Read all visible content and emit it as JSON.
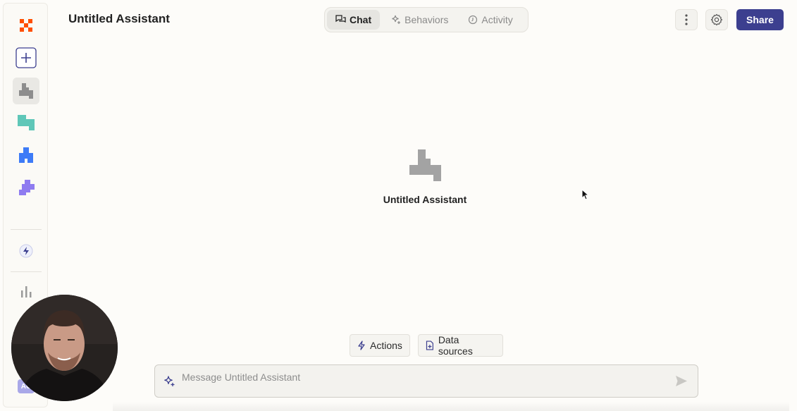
{
  "header": {
    "title": "Untitled Assistant",
    "tabs": [
      {
        "label": "Chat",
        "icon": "chat-bubbles-icon",
        "active": true
      },
      {
        "label": "Behaviors",
        "icon": "sparkle-icon",
        "active": false
      },
      {
        "label": "Activity",
        "icon": "clock-icon",
        "active": false
      }
    ],
    "share_label": "Share"
  },
  "sidebar": {
    "items": [
      {
        "icon": "zapier-logo-icon",
        "color": "#ff4f00"
      },
      {
        "icon": "plus-icon",
        "color": "#3c3f8f"
      },
      {
        "icon": "assistant-icon",
        "color": "#8d8d8d",
        "active": true
      },
      {
        "icon": "table-icon",
        "color": "#5fc7b8"
      },
      {
        "icon": "interface-icon",
        "color": "#3d7bf7"
      },
      {
        "icon": "puzzle-icon",
        "color": "#8f7cf0"
      },
      {
        "icon": "lightning-icon",
        "color": "#3c3f8f"
      },
      {
        "icon": "bar-chart-icon",
        "color": "#9a9a9a"
      }
    ],
    "avatar_initials": "AC"
  },
  "main": {
    "assistant_name": "Untitled Assistant",
    "chips": [
      {
        "label": "Actions",
        "icon": "lightning-icon"
      },
      {
        "label": "Data sources",
        "icon": "file-add-icon"
      }
    ],
    "composer": {
      "placeholder": "Message Untitled Assistant",
      "value": ""
    }
  },
  "colors": {
    "accent": "#3c3f8f",
    "brand": "#ff4f00",
    "background": "#fdfcf9"
  }
}
